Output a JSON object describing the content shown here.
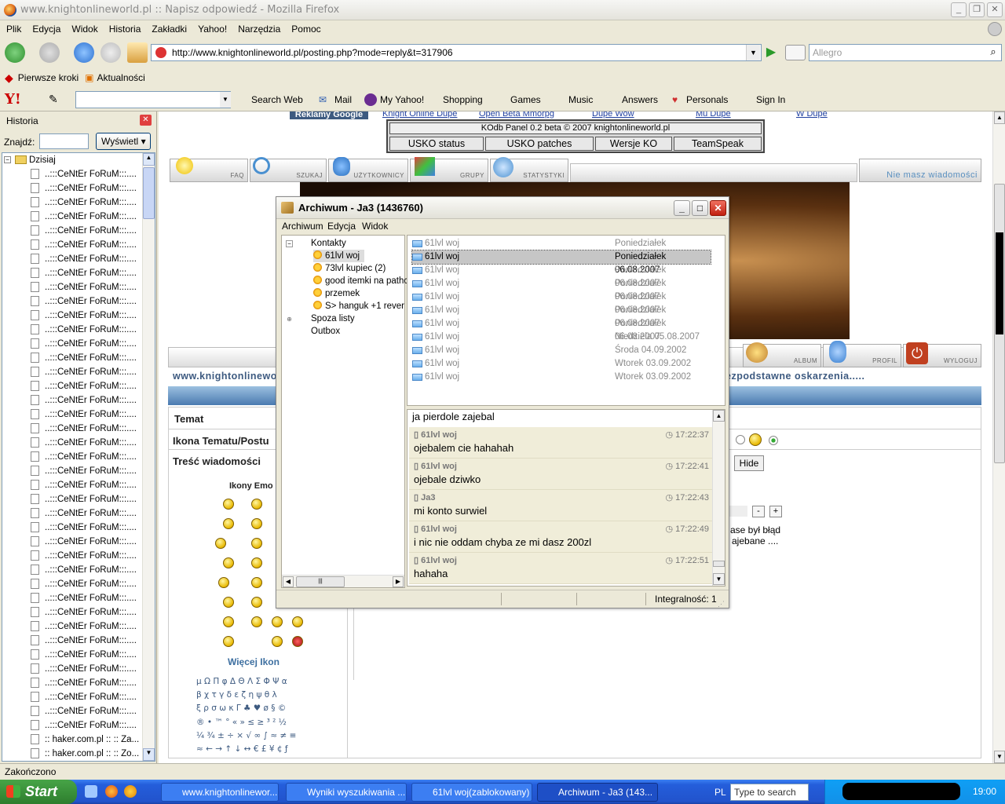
{
  "browser": {
    "title": "www.knightonlineworld.pl :: Napisz odpowiedź - Mozilla Firefox",
    "menu": [
      "Plik",
      "Edycja",
      "Widok",
      "Historia",
      "Zakładki",
      "Yahoo!",
      "Narzędzia",
      "Pomoc"
    ],
    "url": "http://www.knightonlineworld.pl/posting.php?mode=reply&t=317906",
    "search_placeholder": "Allegro",
    "bookmarks": [
      "Pierwsze kroki",
      "Aktualności"
    ],
    "yahoo_toolbar": [
      "Search Web",
      "Mail",
      "My Yahoo!",
      "Shopping",
      "Games",
      "Music",
      "Answers",
      "Personals",
      "Sign In"
    ],
    "status": "Zakończono"
  },
  "sidebar": {
    "title": "Historia",
    "find_label": "Znajdź:",
    "view_button": "Wyświetl",
    "folder": "Dzisiaj",
    "items": [
      "..:::CeNtEr FoRuM:::....",
      "..:::CeNtEr FoRuM:::....",
      "..:::CeNtEr FoRuM:::....",
      "..:::CeNtEr FoRuM:::....",
      "..:::CeNtEr FoRuM:::....",
      "..:::CeNtEr FoRuM:::....",
      "..:::CeNtEr FoRuM:::....",
      "..:::CeNtEr FoRuM:::....",
      "..:::CeNtEr FoRuM:::....",
      "..:::CeNtEr FoRuM:::....",
      "..:::CeNtEr FoRuM:::....",
      "..:::CeNtEr FoRuM:::....",
      "..:::CeNtEr FoRuM:::....",
      "..:::CeNtEr FoRuM:::....",
      "..:::CeNtEr FoRuM:::....",
      "..:::CeNtEr FoRuM:::....",
      "..:::CeNtEr FoRuM:::....",
      "..:::CeNtEr FoRuM:::....",
      "..:::CeNtEr FoRuM:::....",
      "..:::CeNtEr FoRuM:::....",
      "..:::CeNtEr FoRuM:::....",
      "..:::CeNtEr FoRuM:::....",
      "..:::CeNtEr FoRuM:::....",
      "..:::CeNtEr FoRuM:::....",
      "..:::CeNtEr FoRuM:::....",
      "..:::CeNtEr FoRuM:::....",
      "..:::CeNtEr FoRuM:::....",
      "..:::CeNtEr FoRuM:::....",
      "..:::CeNtEr FoRuM:::....",
      "..:::CeNtEr FoRuM:::....",
      "..:::CeNtEr FoRuM:::....",
      "..:::CeNtEr FoRuM:::....",
      "..:::CeNtEr FoRuM:::....",
      "..:::CeNtEr FoRuM:::....",
      "..:::CeNtEr FoRuM:::....",
      "..:::CeNtEr FoRuM:::....",
      "..:::CeNtEr FoRuM:::....",
      "..:::CeNtEr FoRuM:::....",
      "..:::CeNtEr FoRuM:::....",
      "..:::CeNtEr FoRuM:::....",
      ":: haker.com.pl :: :: Za...",
      ":: haker.com.pl :: :: Zo..."
    ]
  },
  "page": {
    "top_links": [
      "Reklamy Google",
      "Knight Online Dupe",
      "Open Beta Mmorpg",
      "Dupe Wow",
      "Mu Dupe",
      "W Dupe"
    ],
    "panel_title": "KOdb Panel 0.2 beta © 2007 knightonlineworld.pl",
    "panel_buttons": [
      "USKO status",
      "USKO patches",
      "Wersje KO",
      "TeamSpeak"
    ],
    "nav_tabs": [
      "FAQ",
      "SZUKAJ",
      "UŻYTKOWNICY",
      "GRUPY",
      "STATYSTYKI"
    ],
    "no_messages": "Nie masz wiadomości",
    "nav_tabs_2": [
      "ALBUM",
      "PROFIL",
      "WYLOGUJ"
    ],
    "breadcrumb": "www.knightonlinewo",
    "breadcrumb_right": "ezpodstawne oskarzenia.....",
    "form_labels": [
      "Temat",
      "Ikona Tematu/Postu",
      "Treść wiadomości"
    ],
    "emoticons_header": "Ikony Emo",
    "more_icons": "Więcej Ikon",
    "hide_button": "Hide",
    "side_text_1": "ase był błąd",
    "side_text_2": "ajebane ....",
    "chars": [
      "μ Ω Π φ Δ Θ Λ Σ Φ Ψ α",
      "β χ τ γ δ ε ζ η ψ θ λ",
      "ξ ρ σ ω κ Γ ♣ ♥ ø § ©",
      "® • ™ ° « » ≤ ≥ ³ ² ½",
      "¼ ¾ ± ÷ × √ ∞ ∫ ≈ ≠ ≡",
      "≈ ← → ↑ ↓ ↔ € £ ¥ ¢ ƒ"
    ]
  },
  "archive": {
    "title": "Archiwum - Ja3 (1436760)",
    "menu": [
      "Archiwum",
      "Edycja",
      "Widok"
    ],
    "tree": {
      "contacts": "Kontakty",
      "children": [
        "61lvl woj",
        "73lvl kupiec (2)",
        "good itemki na pathc",
        "przemek",
        "S> hanguk +1 rever"
      ],
      "off_list": "Spoza listy",
      "outbox": "Outbox"
    },
    "list": [
      {
        "name": "61lvl woj",
        "date": "Poniedziałek 06.08.2007"
      },
      {
        "name": "61lvl woj",
        "date": "Poniedziałek 06.08.2007",
        "selected": true
      },
      {
        "name": "61lvl woj",
        "date": "Poniedziałek 06.08.2007"
      },
      {
        "name": "61lvl woj",
        "date": "Poniedziałek 06.08.2007"
      },
      {
        "name": "61lvl woj",
        "date": "Poniedziałek 06.08.2007"
      },
      {
        "name": "61lvl woj",
        "date": "Poniedziałek 06.08.2007"
      },
      {
        "name": "61lvl woj",
        "date": "Poniedziałek 06.08.2007"
      },
      {
        "name": "61lvl woj",
        "date": "Niedziela 05.08.2007"
      },
      {
        "name": "61lvl woj",
        "date": "Środa 04.09.2002"
      },
      {
        "name": "61lvl woj",
        "date": "Wtorek 03.09.2002"
      },
      {
        "name": "61lvl woj",
        "date": "Wtorek 03.09.2002"
      }
    ],
    "first_line": "ja pierdole zajebal",
    "messages": [
      {
        "who": "61lvl woj",
        "time": "17:22:37",
        "text": "ojebalem cie hahahah"
      },
      {
        "who": "61lvl woj",
        "time": "17:22:41",
        "text": "ojebale dziwko"
      },
      {
        "who": "Ja3",
        "time": "17:22:43",
        "text": "mi konto surwiel"
      },
      {
        "who": "61lvl woj",
        "time": "17:22:49",
        "text": "i nic nie oddam chyba ze mi dasz 200zl"
      },
      {
        "who": "61lvl woj",
        "time": "17:22:51",
        "text": "hahaha"
      }
    ],
    "status": "Integralność: 1"
  },
  "taskbar": {
    "start": "Start",
    "tasks": [
      "www.knightonlinewor...",
      "Wyniki wyszukiwania ...",
      "61lvl woj(zablokowany)",
      "Archiwum - Ja3 (143..."
    ],
    "lang": "PL",
    "search_placeholder": "Type to search",
    "clock": "19:00"
  }
}
